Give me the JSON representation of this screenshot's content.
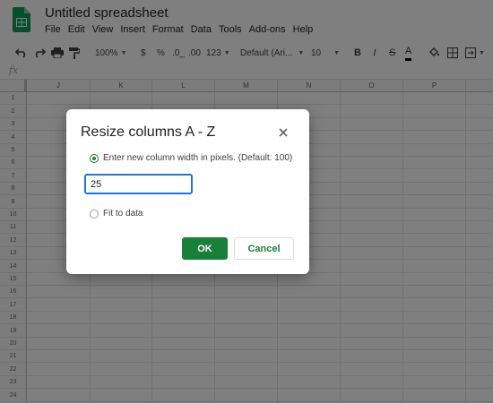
{
  "app": {
    "title": "Untitled spreadsheet",
    "menu": [
      "File",
      "Edit",
      "View",
      "Insert",
      "Format",
      "Data",
      "Tools",
      "Add-ons",
      "Help"
    ]
  },
  "toolbar": {
    "zoom": "100%",
    "currency": "$",
    "percent": "%",
    "decrease_decimals": ".0_",
    "increase_decimals": ".00",
    "more_formats": "123",
    "font": "Default (Ari...",
    "font_size": "10",
    "bold": "B",
    "italic": "I",
    "strikethrough": "S",
    "text_color": "A"
  },
  "formula_bar": {
    "fx_label": "fx"
  },
  "grid": {
    "columns": [
      "J",
      "K",
      "L",
      "M",
      "N",
      "O",
      "P"
    ],
    "rows": [
      "1",
      "2",
      "3",
      "4",
      "5",
      "6",
      "7",
      "8",
      "9",
      "10",
      "11",
      "12",
      "13",
      "14",
      "15",
      "16",
      "17",
      "18",
      "19",
      "20",
      "21",
      "22",
      "23",
      "24"
    ]
  },
  "dialog": {
    "title": "Resize columns A - Z",
    "option_pixels": "Enter new column width in pixels. (Default: 100)",
    "width_value": "25",
    "option_fit": "Fit to data",
    "selected_option": "pixels",
    "ok_label": "OK",
    "cancel_label": "Cancel"
  },
  "colors": {
    "accent": "#188038",
    "focus": "#1a73e8",
    "overlay": "rgba(0,0,0,0.5)"
  }
}
